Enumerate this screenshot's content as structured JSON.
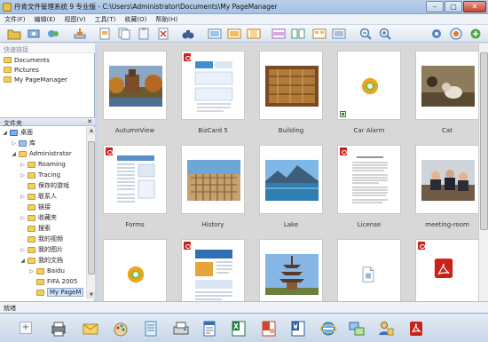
{
  "window": {
    "title": "丹青文件管理系统 9 专业版 - C:\\Users\\Administrator\\Documents\\My PageManager",
    "minimize": "–",
    "maximize": "□",
    "close": "✕"
  },
  "menu": {
    "items": [
      {
        "label": "文件(F)"
      },
      {
        "label": "编辑(E)"
      },
      {
        "label": "视图(V)"
      },
      {
        "label": "工具(T)"
      },
      {
        "label": "收藏(O)"
      },
      {
        "label": "帮助(H)"
      }
    ]
  },
  "quick_links": {
    "header": "快速链接",
    "items": [
      {
        "label": "Documents"
      },
      {
        "label": "Pictures"
      },
      {
        "label": "My PageManager"
      }
    ]
  },
  "folder_tree": {
    "header": "文件夹",
    "close": "✕",
    "items": [
      {
        "label": "桌面"
      },
      {
        "label": "库"
      },
      {
        "label": "Administrator"
      },
      {
        "label": "Roaming"
      },
      {
        "label": "Tracing"
      },
      {
        "label": "保存的游戏"
      },
      {
        "label": "联系人"
      },
      {
        "label": "链接"
      },
      {
        "label": "收藏夹"
      },
      {
        "label": "搜索"
      },
      {
        "label": "我的视频"
      },
      {
        "label": "我的图片"
      },
      {
        "label": "我的文档"
      },
      {
        "label": "Baidu"
      },
      {
        "label": "FIFA 2005"
      },
      {
        "label": "My PageM"
      }
    ]
  },
  "thumbnails": [
    {
      "label": "AutumnView",
      "kind": "photo-autumn",
      "pdf": false,
      "shortcut": false
    },
    {
      "label": "BizCard 5",
      "kind": "doc-bizcard",
      "pdf": true,
      "shortcut": false
    },
    {
      "label": "Building",
      "kind": "photo-building",
      "pdf": false,
      "shortcut": false
    },
    {
      "label": "Car Alarm",
      "kind": "icon-app",
      "pdf": false,
      "shortcut": true
    },
    {
      "label": "Cat",
      "kind": "photo-cat",
      "pdf": false,
      "shortcut": false
    },
    {
      "label": "Forms",
      "kind": "doc-forms",
      "pdf": true,
      "shortcut": false
    },
    {
      "label": "History",
      "kind": "photo-colosseum",
      "pdf": false,
      "shortcut": false
    },
    {
      "label": "Lake",
      "kind": "photo-lake",
      "pdf": false,
      "shortcut": false
    },
    {
      "label": "License",
      "kind": "doc-text",
      "pdf": true,
      "shortcut": false
    },
    {
      "label": "meeting-room",
      "kind": "photo-meeting",
      "pdf": false,
      "shortcut": false
    },
    {
      "label": "",
      "kind": "icon-app",
      "pdf": false,
      "shortcut": false
    },
    {
      "label": "",
      "kind": "doc-flyer",
      "pdf": true,
      "shortcut": false
    },
    {
      "label": "",
      "kind": "photo-pagoda",
      "pdf": false,
      "shortcut": false
    },
    {
      "label": "",
      "kind": "icon-file",
      "pdf": false,
      "shortcut": false
    },
    {
      "label": "",
      "kind": "doc-pdf",
      "pdf": true,
      "shortcut": false
    }
  ],
  "status": {
    "text": "就绪"
  },
  "taskbar": {
    "add": "+"
  }
}
